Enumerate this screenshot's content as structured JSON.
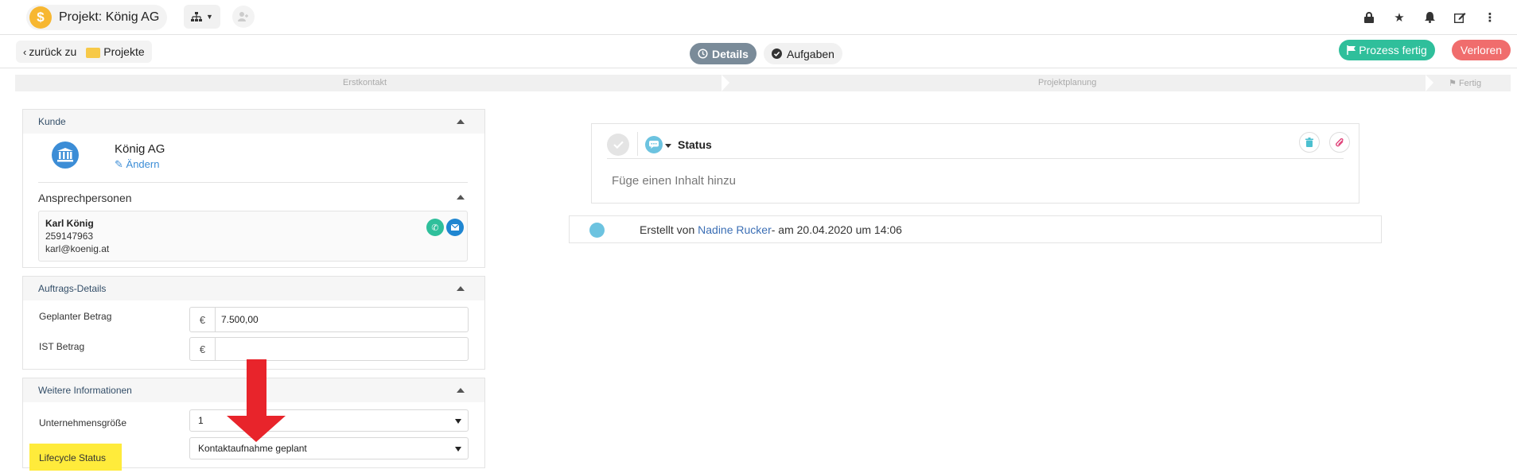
{
  "header": {
    "project_title": "Projekt: König AG"
  },
  "nav": {
    "back_label": "zurück zu",
    "projects_label": "Projekte",
    "tabs": [
      {
        "label": "Details"
      },
      {
        "label": "Aufgaben"
      }
    ],
    "finish_label": "Prozess fertig",
    "lost_label": "Verloren"
  },
  "stages": [
    {
      "label": "Erstkontakt"
    },
    {
      "label": "Projektplanung"
    },
    {
      "label": "Fertig"
    }
  ],
  "customer": {
    "heading": "Kunde",
    "name": "König AG",
    "edit_label": "Ändern",
    "contacts_heading": "Ansprechpersonen",
    "contact": {
      "name": "Karl König",
      "phone": "259147963",
      "email": "karl@koenig.at"
    }
  },
  "order": {
    "heading": "Auftrags-Details",
    "planned_label": "Geplanter Betrag",
    "planned_currency": "€",
    "planned_value": "7.500,00",
    "actual_label": "IST Betrag",
    "actual_currency": "€",
    "actual_value": ""
  },
  "more": {
    "heading": "Weitere Informationen",
    "size_label": "Unternehmensgröße",
    "size_value": "1",
    "lifecycle_label": "Lifecycle Status",
    "lifecycle_value": "Kontaktaufnahme geplant"
  },
  "status_card": {
    "title": "Status",
    "placeholder": "Füge einen Inhalt hinzu"
  },
  "activity": {
    "prefix": "Erstellt von",
    "author": "Nadine Rucker",
    "suffix": "- am 20.04.2020 um 14:06"
  },
  "colors": {
    "accent_green": "#2fbf9b",
    "accent_red": "#f06d6d",
    "highlight_yellow": "#ffeb3b",
    "annotation_red": "#e8242b"
  }
}
